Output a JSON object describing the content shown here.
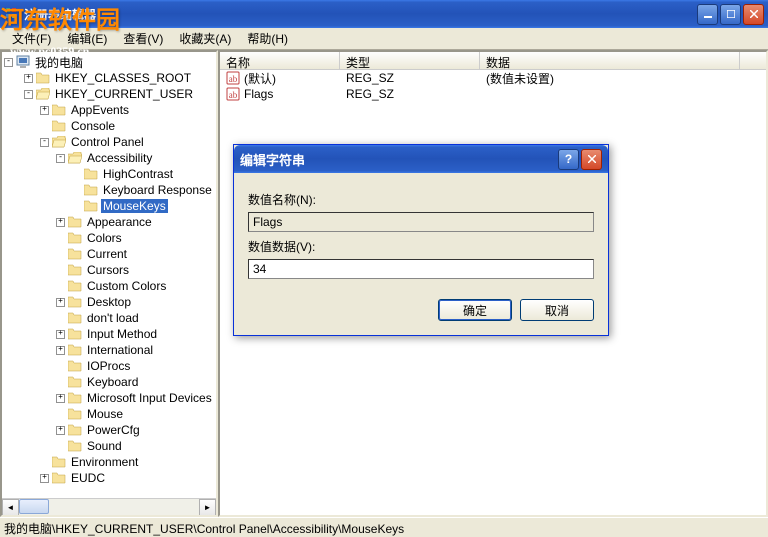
{
  "window": {
    "title": "注册表编辑器"
  },
  "watermark": {
    "main": "河东软件园",
    "sub": "www.pc0359.cn"
  },
  "menu": {
    "file": "文件(F)",
    "edit": "编辑(E)",
    "view": "查看(V)",
    "favorites": "收藏夹(A)",
    "help": "帮助(H)"
  },
  "tree": {
    "root": "我的电脑",
    "items": [
      {
        "label": "HKEY_CLASSES_ROOT",
        "indent": 1,
        "expander": "+"
      },
      {
        "label": "HKEY_CURRENT_USER",
        "indent": 1,
        "expander": "-"
      },
      {
        "label": "AppEvents",
        "indent": 2,
        "expander": "+"
      },
      {
        "label": "Console",
        "indent": 2,
        "expander": ""
      },
      {
        "label": "Control Panel",
        "indent": 2,
        "expander": "-"
      },
      {
        "label": "Accessibility",
        "indent": 3,
        "expander": "-"
      },
      {
        "label": "HighContrast",
        "indent": 4,
        "expander": ""
      },
      {
        "label": "Keyboard Response",
        "indent": 4,
        "expander": ""
      },
      {
        "label": "MouseKeys",
        "indent": 4,
        "expander": "",
        "selected": true
      },
      {
        "label": "Appearance",
        "indent": 3,
        "expander": "+"
      },
      {
        "label": "Colors",
        "indent": 3,
        "expander": ""
      },
      {
        "label": "Current",
        "indent": 3,
        "expander": ""
      },
      {
        "label": "Cursors",
        "indent": 3,
        "expander": ""
      },
      {
        "label": "Custom Colors",
        "indent": 3,
        "expander": ""
      },
      {
        "label": "Desktop",
        "indent": 3,
        "expander": "+"
      },
      {
        "label": "don't load",
        "indent": 3,
        "expander": ""
      },
      {
        "label": "Input Method",
        "indent": 3,
        "expander": "+"
      },
      {
        "label": "International",
        "indent": 3,
        "expander": "+"
      },
      {
        "label": "IOProcs",
        "indent": 3,
        "expander": ""
      },
      {
        "label": "Keyboard",
        "indent": 3,
        "expander": ""
      },
      {
        "label": "Microsoft Input Devices",
        "indent": 3,
        "expander": "+"
      },
      {
        "label": "Mouse",
        "indent": 3,
        "expander": ""
      },
      {
        "label": "PowerCfg",
        "indent": 3,
        "expander": "+"
      },
      {
        "label": "Sound",
        "indent": 3,
        "expander": ""
      },
      {
        "label": "Environment",
        "indent": 2,
        "expander": ""
      },
      {
        "label": "EUDC",
        "indent": 2,
        "expander": "+"
      }
    ]
  },
  "list": {
    "headers": {
      "name": "名称",
      "type": "类型",
      "data": "数据"
    },
    "cols": {
      "name": 120,
      "type": 140,
      "data": 260
    },
    "rows": [
      {
        "name": "(默认)",
        "type": "REG_SZ",
        "data": "(数值未设置)"
      },
      {
        "name": "Flags",
        "type": "REG_SZ",
        "data": ""
      }
    ]
  },
  "dialog": {
    "title": "编辑字符串",
    "name_label": "数值名称(N):",
    "name_value": "Flags",
    "data_label": "数值数据(V):",
    "data_value": "34",
    "ok": "确定",
    "cancel": "取消"
  },
  "statusbar": {
    "path": "我的电脑\\HKEY_CURRENT_USER\\Control Panel\\Accessibility\\MouseKeys"
  }
}
